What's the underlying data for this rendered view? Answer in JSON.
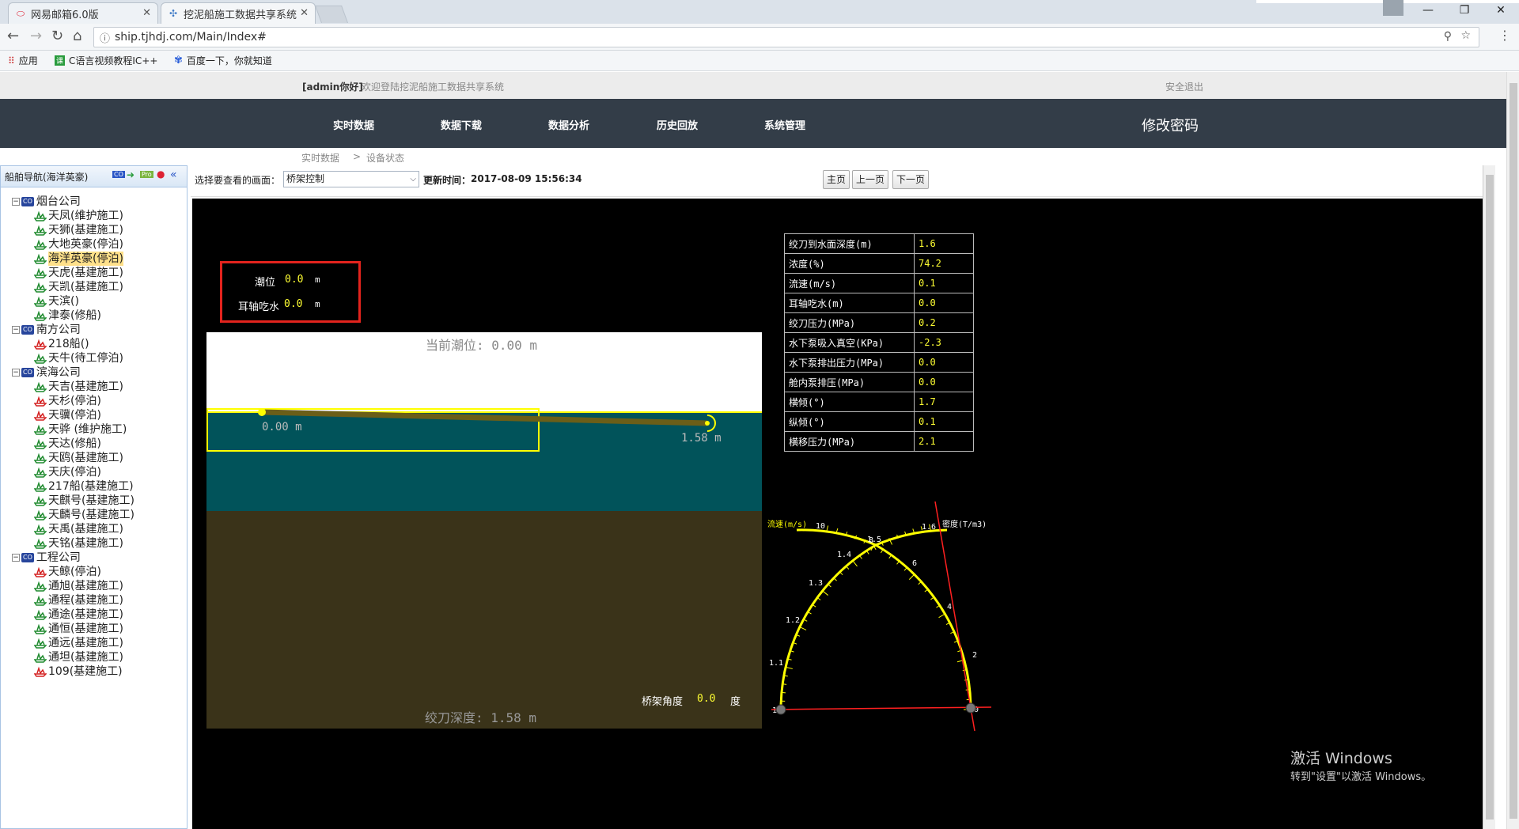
{
  "browser": {
    "tabs": [
      {
        "label": "网易邮箱6.0版",
        "active": false
      },
      {
        "label": "挖泥船施工数据共享系统",
        "active": true
      }
    ],
    "url": "ship.tjhdj.com/Main/Index#",
    "bookmarks": [
      {
        "label": "应用"
      },
      {
        "label": "C语言视频教程IC++"
      },
      {
        "label": "百度一下，你就知道"
      }
    ]
  },
  "header": {
    "user": "[admin你好]",
    "welcome": "欢迎登陆挖泥船施工数据共享系统",
    "logout": "安全退出",
    "nav": [
      "实时数据",
      "数据下载",
      "数据分析",
      "历史回放",
      "系统管理"
    ],
    "change_password": "修改密码"
  },
  "breadcrumb": {
    "root": "实时数据",
    "sep": ">",
    "current": "设备状态"
  },
  "sidebar": {
    "title": "船舶导航(海洋英豪)",
    "groups": [
      {
        "name": "烟台公司",
        "ships": [
          {
            "name": "天凤(维护施工)",
            "c": "g"
          },
          {
            "name": "天狮(基建施工)",
            "c": "g"
          },
          {
            "name": "大地英豪(停泊)",
            "c": "g"
          },
          {
            "name": "海洋英豪(停泊)",
            "c": "g",
            "hl": true
          },
          {
            "name": "天虎(基建施工)",
            "c": "g"
          },
          {
            "name": "天凯(基建施工)",
            "c": "g"
          },
          {
            "name": "天滨()",
            "c": "g"
          },
          {
            "name": "津泰(修船)",
            "c": "g"
          }
        ]
      },
      {
        "name": "南方公司",
        "ships": [
          {
            "name": "218船()",
            "c": "r"
          },
          {
            "name": "天牛(待工停泊)",
            "c": "g"
          }
        ]
      },
      {
        "name": "滨海公司",
        "ships": [
          {
            "name": "天吉(基建施工)",
            "c": "g"
          },
          {
            "name": "天杉(停泊)",
            "c": "r"
          },
          {
            "name": "天骥(停泊)",
            "c": "r"
          },
          {
            "name": "天骅 (维护施工)",
            "c": "g"
          },
          {
            "name": "天达(修船)",
            "c": "g"
          },
          {
            "name": "天鸥(基建施工)",
            "c": "g"
          },
          {
            "name": "天庆(停泊)",
            "c": "g"
          },
          {
            "name": "217船(基建施工)",
            "c": "g"
          },
          {
            "name": "天麒号(基建施工)",
            "c": "g"
          },
          {
            "name": "天麟号(基建施工)",
            "c": "g"
          },
          {
            "name": "天禹(基建施工)",
            "c": "g"
          },
          {
            "name": "天铭(基建施工)",
            "c": "g"
          }
        ]
      },
      {
        "name": "工程公司",
        "ships": [
          {
            "name": "天鲸(停泊)",
            "c": "r"
          },
          {
            "name": "通旭(基建施工)",
            "c": "g"
          },
          {
            "name": "通程(基建施工)",
            "c": "g"
          },
          {
            "name": "通途(基建施工)",
            "c": "g"
          },
          {
            "name": "通恒(基建施工)",
            "c": "g"
          },
          {
            "name": "通远(基建施工)",
            "c": "g"
          },
          {
            "name": "通坦(基建施工)",
            "c": "g"
          },
          {
            "name": "109(基建施工)",
            "c": "r"
          }
        ]
      }
    ]
  },
  "controls": {
    "select_label": "选择要查看的画面：",
    "select_value": "桥架控制",
    "update_label": "更新时间：",
    "update_time": "2017-08-09 15:56:34",
    "btn_home": "主页",
    "btn_prev": "上一页",
    "btn_next": "下一页"
  },
  "tide": {
    "tide_label": "潮位",
    "tide_value": "0.0",
    "tide_unit": "m",
    "draft_label": "耳轴吃水",
    "draft_value": "0.0",
    "draft_unit": "m"
  },
  "ladder": {
    "current_tide": "当前潮位: 0.00 m",
    "left_depth": "0.00 m",
    "right_depth": "1.58 m",
    "ladder_angle_label": "桥架角度",
    "ladder_angle_value": "0.0",
    "ladder_angle_unit": "度",
    "cutter_depth": "绞刀深度: 1.58 m"
  },
  "table": [
    {
      "k": "绞刀到水面深度(m)",
      "v": "1.6"
    },
    {
      "k": "浓度(%)",
      "v": "74.2"
    },
    {
      "k": "流速(m/s)",
      "v": "0.1"
    },
    {
      "k": "耳轴吃水(m)",
      "v": "0.0"
    },
    {
      "k": "绞刀压力(MPa)",
      "v": "0.2"
    },
    {
      "k": "水下泵吸入真空(KPa)",
      "v": "-2.3"
    },
    {
      "k": "水下泵排出压力(MPa)",
      "v": "0.0"
    },
    {
      "k": "舱内泵排压(MPa)",
      "v": "0.0"
    },
    {
      "k": "横倾(°)",
      "v": "1.7"
    },
    {
      "k": "纵倾(°)",
      "v": "0.1"
    },
    {
      "k": "横移压力(MPa)",
      "v": "2.1"
    }
  ],
  "gauge": {
    "left_label": "流速(m/s)",
    "right_label": "密度(T/m3)",
    "density_ticks": [
      "1",
      "1.1",
      "1.2",
      "1.3",
      "1.4",
      "1.5",
      "1.6"
    ],
    "velocity_ticks": [
      "0",
      "2",
      "4",
      "6",
      "8",
      "10"
    ]
  },
  "watermark": {
    "line1": "激活 Windows",
    "line2": "转到\"设置\"以激活 Windows。"
  },
  "colors": {
    "nav_bg": "#333d48",
    "water": "#01535a",
    "soil": "#3a3319",
    "gauge_yellow": "#ffff00",
    "alert_red": "#e3231d"
  }
}
